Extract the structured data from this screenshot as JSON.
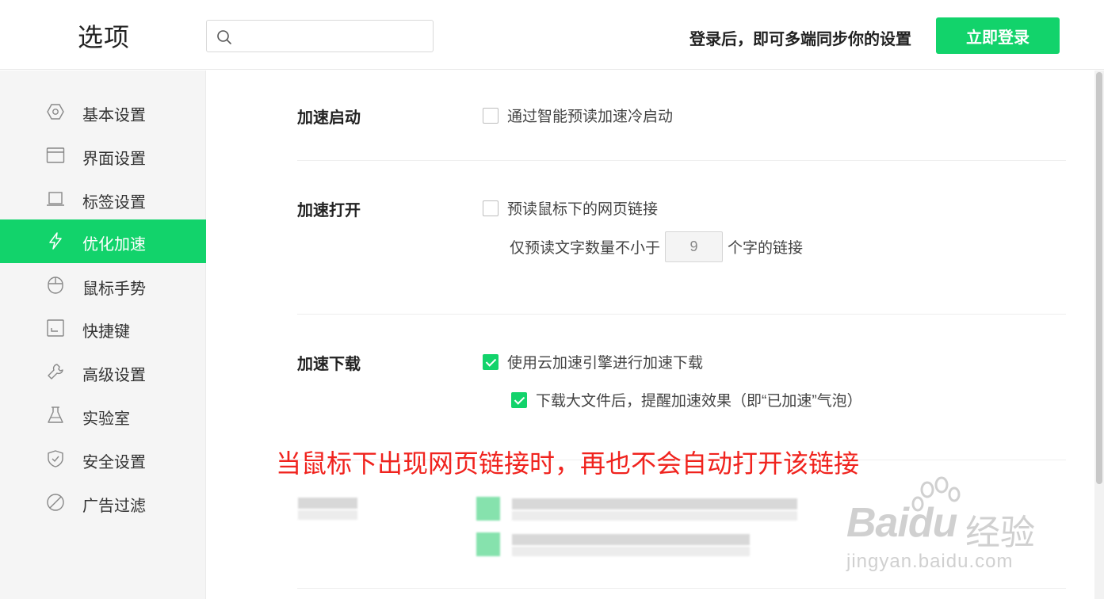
{
  "header": {
    "title": "选项",
    "search_placeholder": "",
    "login_hint": "登录后，即可多端同步你的设置",
    "login_button": "立即登录"
  },
  "sidebar": {
    "items": [
      {
        "label": "基本设置",
        "icon": "hexagon-gear-icon"
      },
      {
        "label": "界面设置",
        "icon": "window-icon"
      },
      {
        "label": "标签设置",
        "icon": "tab-icon"
      },
      {
        "label": "优化加速",
        "icon": "lightning-icon",
        "active": true
      },
      {
        "label": "鼠标手势",
        "icon": "mouse-icon"
      },
      {
        "label": "快捷键",
        "icon": "keyboard-key-icon"
      },
      {
        "label": "高级设置",
        "icon": "wrench-icon"
      },
      {
        "label": "实验室",
        "icon": "flask-icon"
      },
      {
        "label": "安全设置",
        "icon": "shield-icon"
      },
      {
        "label": "广告过滤",
        "icon": "block-icon"
      }
    ]
  },
  "sections": {
    "startup": {
      "title": "加速启动",
      "option": "通过智能预读加速冷启动",
      "checked": false
    },
    "open": {
      "title": "加速打开",
      "option": "预读鼠标下的网页链接",
      "checked": false,
      "min_chars_prefix": "仅预读文字数量不小于",
      "min_chars_value": "9",
      "min_chars_suffix": "个字的链接"
    },
    "download": {
      "title": "加速下载",
      "option": "使用云加速引擎进行加速下载",
      "checked": true,
      "sub_option": "下载大文件后，提醒加速效果（即“已加速”气泡）",
      "sub_checked": true
    }
  },
  "caption": "当鼠标下出现网页链接时，再也不会自动打开该链接",
  "watermark": {
    "brand": "Baidu",
    "cn": "经验",
    "url": "jingyan.baidu.com"
  },
  "colors": {
    "accent": "#12d36b",
    "caption": "#f0231e"
  }
}
